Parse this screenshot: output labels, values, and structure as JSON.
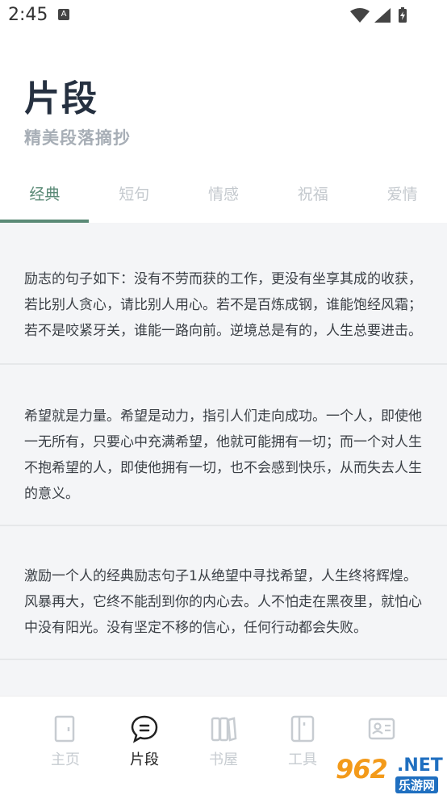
{
  "status_bar": {
    "time": "2:45",
    "notification_icon": "a-icon",
    "wifi_icon": "wifi-icon",
    "signal_icon": "signal-icon",
    "battery_icon": "battery-charging-icon"
  },
  "header": {
    "title": "片段",
    "subtitle": "精美段落摘抄"
  },
  "tabs": [
    {
      "label": "经典",
      "active": true
    },
    {
      "label": "短句",
      "active": false
    },
    {
      "label": "情感",
      "active": false
    },
    {
      "label": "祝福",
      "active": false
    },
    {
      "label": "爱情",
      "active": false
    }
  ],
  "cards": [
    {
      "text": "励志的句子如下：没有不劳而获的工作，更没有坐享其成的收获，若比别人贪心，请比别人用心。若不是百炼成钢，谁能饱经风霜；若不是咬紧牙关，谁能一路向前。逆境总是有的，人生总要进击。"
    },
    {
      "text": "希望就是力量。希望是动力，指引人们走向成功。一个人，即使他一无所有，只要心中充满希望，他就可能拥有一切；而一个对人生不抱希望的人，即使他拥有一切，也不会感到快乐，从而失去人生的意义。"
    },
    {
      "text": "激励一个人的经典励志句子1从绝望中寻找希望，人生终将辉煌。风暴再大，它终不能刮到你的内心去。人不怕走在黑夜里，就怕心中没有阳光。没有坚定不移的信心，任何行动都会失败。"
    }
  ],
  "bottom_nav": [
    {
      "label": "主页",
      "icon": "door-icon",
      "active": false
    },
    {
      "label": "片段",
      "icon": "chat-bubble-icon",
      "active": true
    },
    {
      "label": "书屋",
      "icon": "books-icon",
      "active": false
    },
    {
      "label": "工具",
      "icon": "toolbox-icon",
      "active": false
    },
    {
      "label": "",
      "icon": "id-card-icon",
      "active": false
    }
  ],
  "watermark": {
    "logo": "962",
    "domain": ".NET",
    "tagline": "乐游网"
  },
  "colors": {
    "accent": "#5a8a76",
    "title": "#253040",
    "subtitle": "#a7aeb6",
    "inactive": "#c4c9ce",
    "content_bg": "#f4f5f7"
  }
}
